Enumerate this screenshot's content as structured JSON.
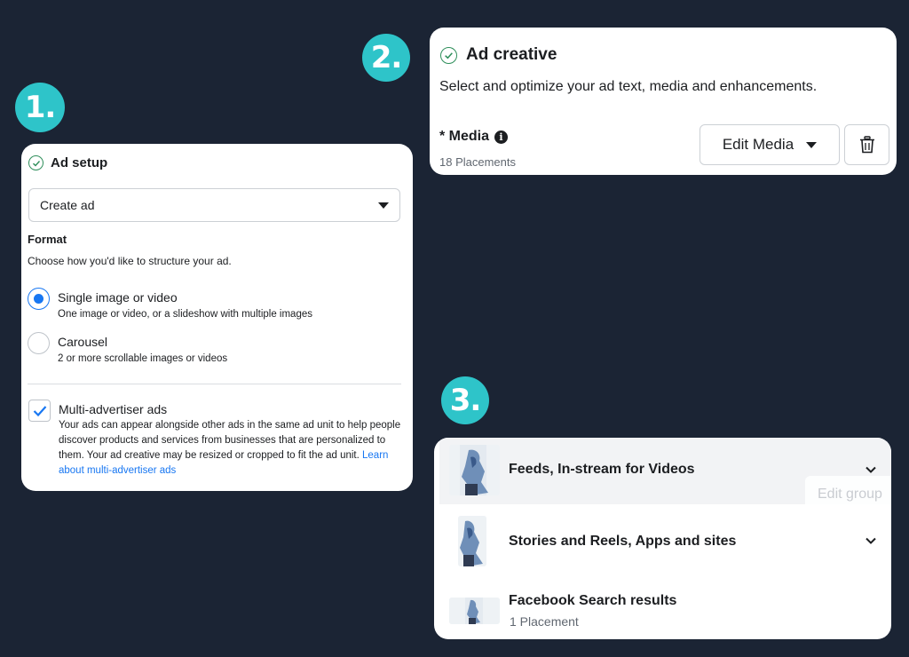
{
  "steps": {
    "one": "1.",
    "two": "2.",
    "three": "3."
  },
  "colors": {
    "background": "#1b2434",
    "badge": "#2ec4c9",
    "accent_blue": "#1877f2",
    "check_green": "#2f8f5b"
  },
  "ad_setup": {
    "title": "Ad setup",
    "select_value": "Create ad",
    "format_label": "Format",
    "format_desc": "Choose how you'd like to structure your ad.",
    "options": [
      {
        "title": "Single image or video",
        "sub": "One image or video, or a slideshow with multiple images",
        "selected": true
      },
      {
        "title": "Carousel",
        "sub": "2 or more scrollable images or videos",
        "selected": false
      }
    ],
    "multi_title": "Multi-advertiser ads",
    "multi_desc": "Your ads can appear alongside other ads in the same ad unit to help people discover products and services from businesses that are personalized to them. Your ad creative may be resized or cropped to fit the ad unit.",
    "multi_link": "Learn about multi-advertiser ads",
    "multi_checked": true
  },
  "ad_creative": {
    "title": "Ad creative",
    "desc": "Select and optimize your ad text, media and enhancements.",
    "media_label": "* Media",
    "placements": "18 Placements",
    "edit_media": "Edit Media"
  },
  "placement_groups": {
    "rows": [
      {
        "title": "Feeds, In-stream for Videos",
        "icon": "chevron-down-icon"
      },
      {
        "title": "Stories and Reels, Apps and sites",
        "icon": "chevron-down-icon"
      },
      {
        "title": "Facebook Search results",
        "sub": "1 Placement"
      }
    ],
    "edit_group": "Edit group"
  }
}
